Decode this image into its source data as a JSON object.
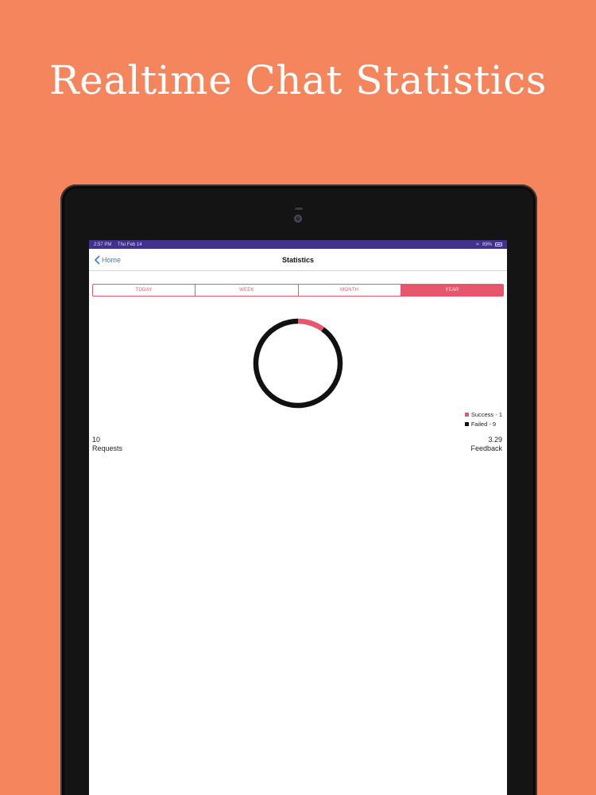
{
  "headline": "Realtime Chat Statistics",
  "status_bar": {
    "time": "2:57 PM",
    "date": "Thu Feb 14",
    "battery": "89%"
  },
  "nav": {
    "back_label": "Home",
    "title": "Statistics"
  },
  "tabs": [
    {
      "label": "TODAY",
      "active": false
    },
    {
      "label": "WEEK",
      "active": false
    },
    {
      "label": "MONTH",
      "active": false
    },
    {
      "label": "YEAR",
      "active": true
    }
  ],
  "colors": {
    "background": "#F4855C",
    "accent": "#E8566E",
    "status_bar": "#43318E",
    "link": "#3B7BD8",
    "failed": "#111111"
  },
  "chart_data": {
    "type": "pie",
    "style": "donut",
    "categories": [
      "Success",
      "Failed"
    ],
    "values": [
      1,
      9
    ],
    "colors": [
      "#E8566E",
      "#111111"
    ]
  },
  "legend": [
    {
      "label": "Success - 1"
    },
    {
      "label": "Failed - 9"
    }
  ],
  "stats": {
    "requests_value": "10",
    "requests_label": "Requests",
    "feedback_value": "3.29",
    "feedback_label": "Feedback"
  }
}
